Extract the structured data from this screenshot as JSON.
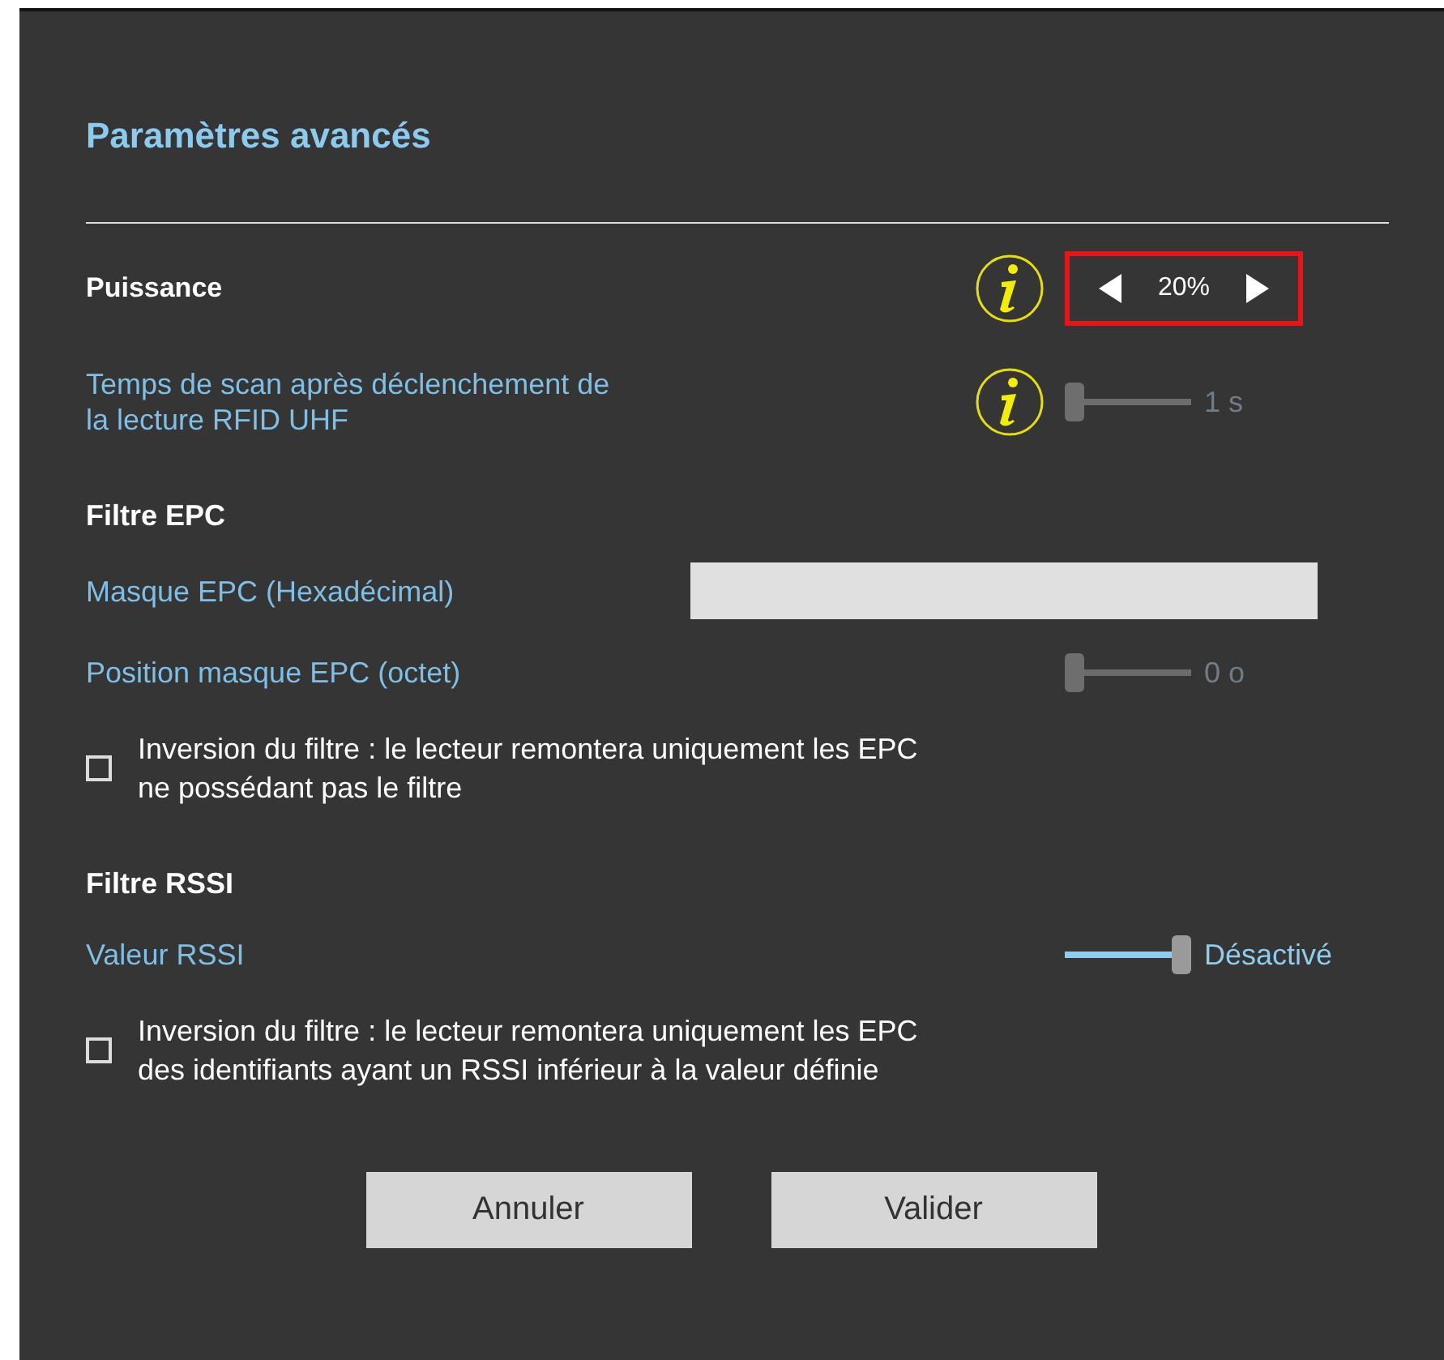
{
  "title": "Paramètres avancés",
  "rows": [
    {
      "kind": "stepper",
      "label": "Puissance",
      "value": "20%",
      "info": true,
      "highlighted": true
    },
    {
      "kind": "slider",
      "label": "Temps de scan après déclenchement de la lecture RFID UHF",
      "info": true,
      "level": 0,
      "reading": "1 s",
      "disabled": true
    },
    {
      "kind": "heading",
      "label": "Filtre EPC"
    },
    {
      "kind": "input",
      "label": "Masque EPC (Hexadécimal)"
    },
    {
      "kind": "slider",
      "label": "Position masque EPC (octet)",
      "info": false,
      "level": 0,
      "reading": "0 o",
      "disabled": true
    },
    {
      "kind": "checkbox",
      "label": "Inversion du filtre : le lecteur remontera uniquement les EPC ne possédant pas le filtre",
      "checked": false
    },
    {
      "kind": "heading",
      "label": "Filtre RSSI"
    },
    {
      "kind": "slider",
      "label": "Valeur RSSI",
      "info": false,
      "level": 1,
      "reading": "Désactivé",
      "disabled": false
    },
    {
      "kind": "checkbox",
      "label": "Inversion du filtre : le lecteur remontera uniquement les EPC des identifiants ayant un RSSI inférieur à la valeur définie",
      "checked": false
    }
  ],
  "buttons": [
    "Annuler",
    "Valider"
  ]
}
